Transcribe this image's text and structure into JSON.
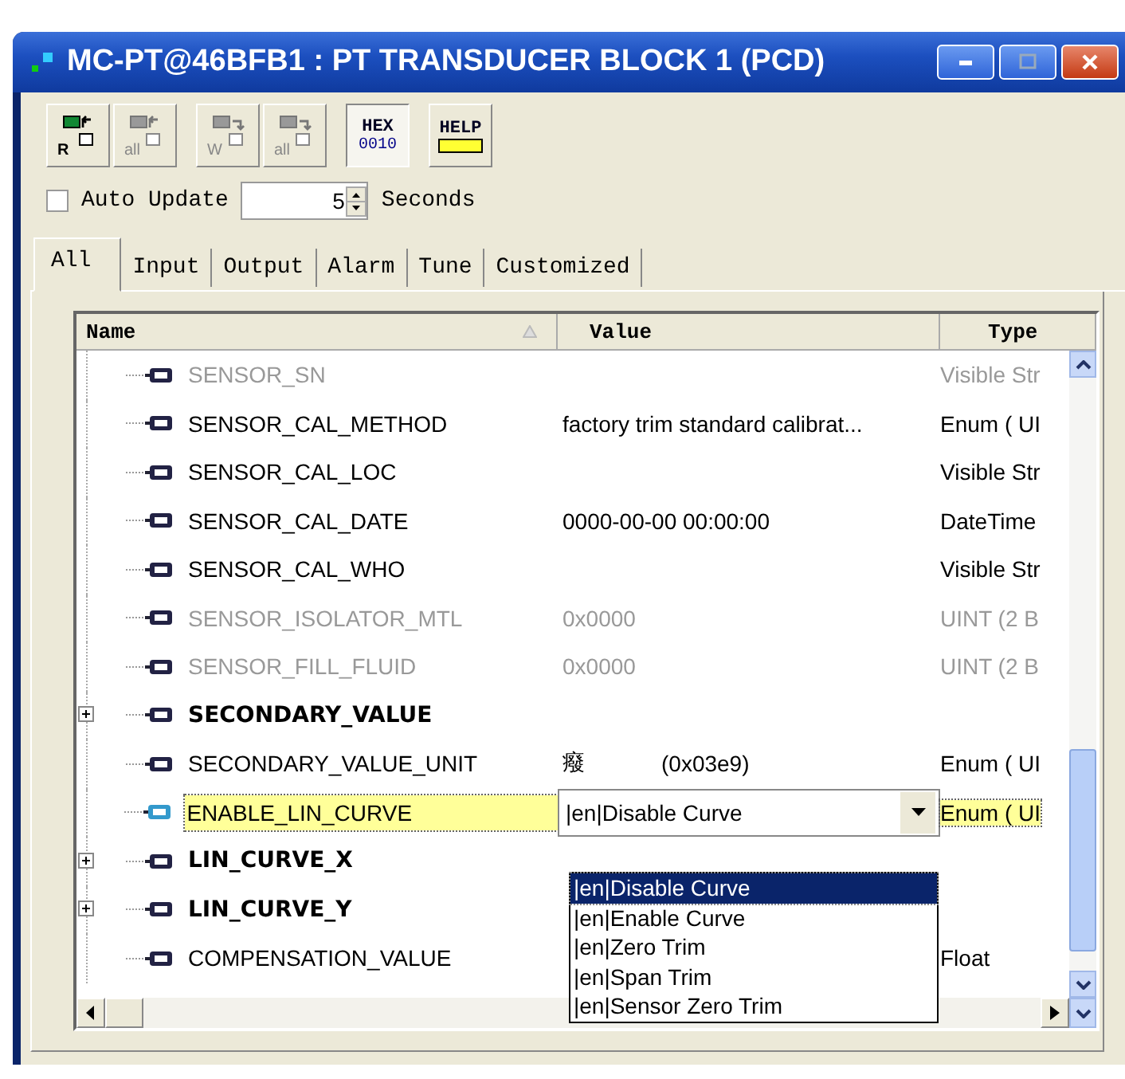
{
  "window": {
    "title": "MC-PT@46BFB1 : PT TRANSDUCER BLOCK 1 (PCD)"
  },
  "toolbar": [
    {
      "label": "R",
      "kind": "read",
      "disabled": false,
      "pressed": false
    },
    {
      "label": "all",
      "kind": "read",
      "disabled": true,
      "pressed": false
    },
    {
      "label": "W",
      "kind": "write",
      "disabled": true,
      "pressed": false
    },
    {
      "label": "all",
      "kind": "write",
      "disabled": true,
      "pressed": false
    },
    {
      "label": "HEX",
      "sub": "0010",
      "kind": "hex",
      "disabled": false,
      "pressed": true
    },
    {
      "label": "HELP",
      "kind": "help",
      "disabled": false,
      "pressed": false
    }
  ],
  "auto_update": {
    "label": "Auto Update",
    "checked": false,
    "value": "5",
    "unit": "Seconds"
  },
  "tabs": [
    {
      "label": "All",
      "selected": true
    },
    {
      "label": "Input",
      "selected": false
    },
    {
      "label": "Output",
      "selected": false
    },
    {
      "label": "Alarm",
      "selected": false
    },
    {
      "label": "Tune",
      "selected": false
    },
    {
      "label": "Customized",
      "selected": false
    }
  ],
  "table": {
    "columns": [
      "Name",
      "Value",
      "Type"
    ],
    "rows": [
      {
        "kind": "param",
        "name": "SENSOR_SN",
        "value": "",
        "type": "Visible Str",
        "disabled": true,
        "selected": false
      },
      {
        "kind": "param",
        "name": "SENSOR_CAL_METHOD",
        "value": "factory trim standard calibrat...",
        "type": "Enum ( UI",
        "disabled": false,
        "selected": false
      },
      {
        "kind": "param",
        "name": "SENSOR_CAL_LOC",
        "value": "",
        "type": "Visible Str",
        "disabled": false,
        "selected": false
      },
      {
        "kind": "param",
        "name": "SENSOR_CAL_DATE",
        "value": "0000-00-00 00:00:00",
        "type": "DateTime",
        "disabled": false,
        "selected": false
      },
      {
        "kind": "param",
        "name": "SENSOR_CAL_WHO",
        "value": "",
        "type": "Visible Str",
        "disabled": false,
        "selected": false
      },
      {
        "kind": "param",
        "name": "SENSOR_ISOLATOR_MTL",
        "value": "0x0000",
        "type": "UINT (2 B",
        "disabled": true,
        "selected": false
      },
      {
        "kind": "param",
        "name": "SENSOR_FILL_FLUID",
        "value": "0x0000",
        "type": "UINT (2 B",
        "disabled": true,
        "selected": false
      },
      {
        "kind": "group",
        "name": "SECONDARY_VALUE",
        "value": "",
        "type": "",
        "disabled": false,
        "selected": false,
        "expanded": false
      },
      {
        "kind": "param",
        "name": "SECONDARY_VALUE_UNIT",
        "value": "癈",
        "code": "(0x03e9)",
        "type": "Enum ( UI",
        "disabled": false,
        "selected": false
      },
      {
        "kind": "param",
        "name": "ENABLE_LIN_CURVE",
        "value": "|en|Disable Curve",
        "type": "Enum ( UI",
        "disabled": false,
        "selected": true,
        "editing": true
      },
      {
        "kind": "group",
        "name": "LIN_CURVE_X",
        "value": "",
        "type": "",
        "disabled": false,
        "selected": false,
        "expanded": false
      },
      {
        "kind": "group",
        "name": "LIN_CURVE_Y",
        "value": "",
        "type": "",
        "disabled": false,
        "selected": false,
        "expanded": false
      },
      {
        "kind": "param",
        "name": "COMPENSATION_VALUE",
        "value": "",
        "type": "Float",
        "disabled": false,
        "selected": false
      }
    ],
    "dropdown": [
      {
        "label": "|en|Disable Curve",
        "selected": true
      },
      {
        "label": "|en|Enable Curve",
        "selected": false
      },
      {
        "label": "|en|Zero Trim",
        "selected": false
      },
      {
        "label": "|en|Span Trim",
        "selected": false
      },
      {
        "label": "|en|Sensor Zero Trim",
        "selected": false
      }
    ]
  }
}
